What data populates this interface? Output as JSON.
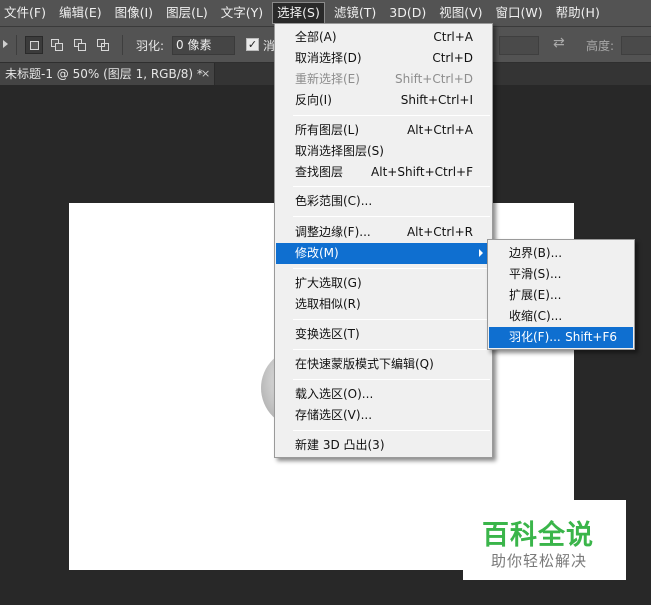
{
  "menubar": {
    "items": [
      {
        "label": "文件(F)"
      },
      {
        "label": "编辑(E)"
      },
      {
        "label": "图像(I)"
      },
      {
        "label": "图层(L)"
      },
      {
        "label": "文字(Y)"
      },
      {
        "label": "选择(S)",
        "active": true
      },
      {
        "label": "滤镜(T)"
      },
      {
        "label": "3D(D)"
      },
      {
        "label": "视图(V)"
      },
      {
        "label": "窗口(W)"
      },
      {
        "label": "帮助(H)"
      }
    ]
  },
  "options": {
    "feather_label": "羽化:",
    "feather_value": "0 像素",
    "antialias_label": "消",
    "antialias_checked": "✓",
    "swap_icon": "⇄",
    "height_label": "高度:"
  },
  "document": {
    "tab_title": "未标题-1 @ 50% (图层 1, RGB/8) *",
    "close": "×"
  },
  "select_menu": {
    "items": [
      {
        "label": "全部(A)",
        "shortcut": "Ctrl+A"
      },
      {
        "label": "取消选择(D)",
        "shortcut": "Ctrl+D"
      },
      {
        "label": "重新选择(E)",
        "shortcut": "Shift+Ctrl+D",
        "disabled": true
      },
      {
        "label": "反向(I)",
        "shortcut": "Shift+Ctrl+I"
      },
      {
        "label": "所有图层(L)",
        "shortcut": "Alt+Ctrl+A"
      },
      {
        "label": "取消选择图层(S)",
        "shortcut": ""
      },
      {
        "label": "查找图层",
        "shortcut": "Alt+Shift+Ctrl+F"
      },
      {
        "label": "色彩范围(C)...",
        "shortcut": ""
      },
      {
        "label": "调整边缘(F)...",
        "shortcut": "Alt+Ctrl+R"
      },
      {
        "label": "修改(M)",
        "shortcut": "",
        "highlighted": true,
        "submenu": true
      },
      {
        "label": "扩大选取(G)",
        "shortcut": ""
      },
      {
        "label": "选取相似(R)",
        "shortcut": ""
      },
      {
        "label": "变换选区(T)",
        "shortcut": ""
      },
      {
        "label": "在快速蒙版模式下编辑(Q)",
        "shortcut": ""
      },
      {
        "label": "载入选区(O)...",
        "shortcut": ""
      },
      {
        "label": "存储选区(V)...",
        "shortcut": ""
      },
      {
        "label": "新建 3D 凸出(3)",
        "shortcut": ""
      }
    ]
  },
  "modify_submenu": {
    "items": [
      {
        "label": "边界(B)...",
        "shortcut": ""
      },
      {
        "label": "平滑(S)...",
        "shortcut": ""
      },
      {
        "label": "扩展(E)...",
        "shortcut": ""
      },
      {
        "label": "收缩(C)...",
        "shortcut": ""
      },
      {
        "label": "羽化(F)...",
        "shortcut": "Shift+F6",
        "highlighted": true
      }
    ]
  },
  "watermark": {
    "title": "百科全说",
    "subtitle": "助你轻松解决"
  },
  "colors": {
    "highlight": "#0f6fd0",
    "menubar": "#535353",
    "workspace": "#282828",
    "watermark_green": "#3ab54a"
  }
}
